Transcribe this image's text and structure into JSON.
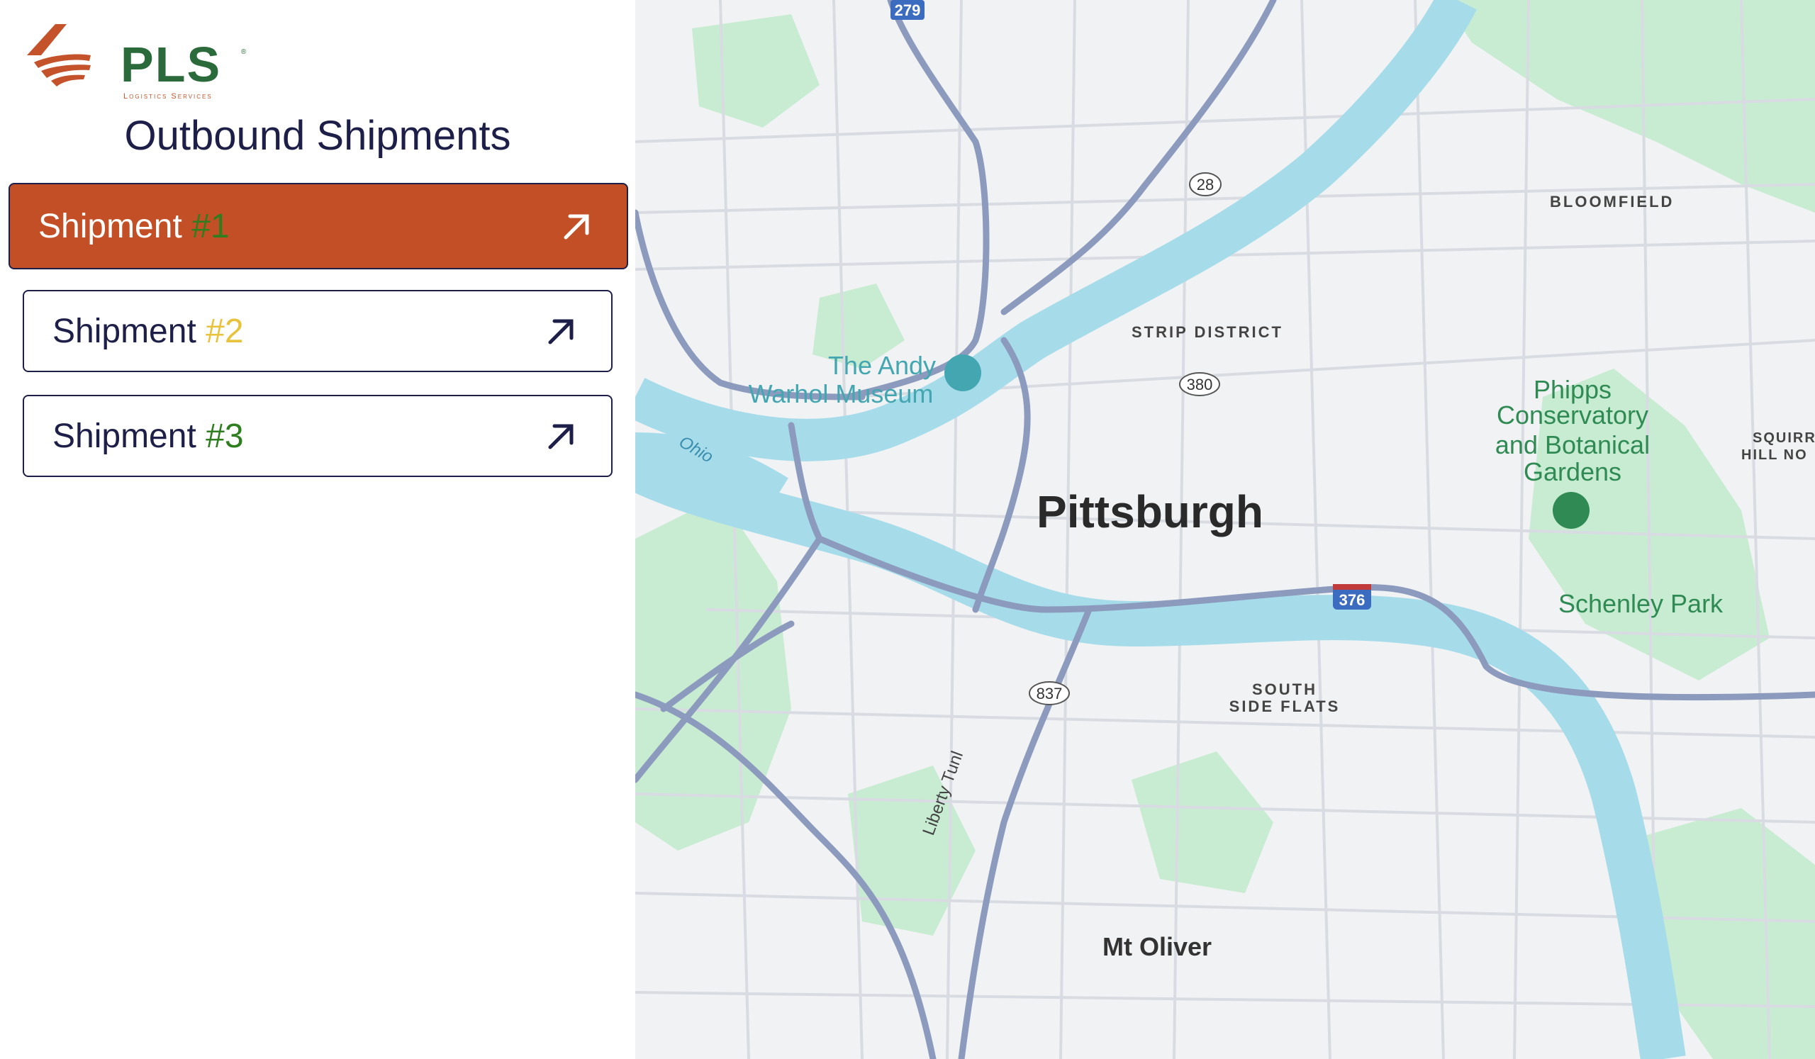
{
  "brand": {
    "name": "PLS",
    "tagline": "Logistics Services",
    "registered": "®",
    "colors": {
      "green": "#2b6a3a",
      "orange": "#c4532b"
    }
  },
  "panel": {
    "title": "Outbound Shipments"
  },
  "shipments": [
    {
      "label": "Shipment ",
      "number": "#1",
      "number_color": "#2e7d1f",
      "active": true,
      "icon": "arrow-up-right-icon"
    },
    {
      "label": "Shipment ",
      "number": "#2",
      "number_color": "#e8c23a",
      "active": false,
      "icon": "arrow-up-right-icon"
    },
    {
      "label": "Shipment ",
      "number": "#3",
      "number_color": "#2e7d1f",
      "active": false,
      "icon": "arrow-up-right-icon"
    }
  ],
  "map": {
    "city": "Pittsburgh",
    "neighborhoods": [
      "BLOOMFIELD",
      "STRIP DISTRICT",
      "SOUTH",
      "SIDE FLATS",
      "SQUIRR",
      "HILL NO"
    ],
    "places": [
      "The Andy",
      "Warhol Museum",
      "Phipps",
      "Conservatory",
      "and Botanical",
      "Gardens",
      "Schenley Park",
      "Mt Oliver"
    ],
    "river": "Ohio",
    "tunnel": "Liberty Tunl",
    "route_shields": [
      "279",
      "28",
      "380",
      "837",
      "376"
    ],
    "colors": {
      "water": "#a6dcea",
      "park": "#c8ecd2",
      "highway": "#8c9bbd",
      "poi": "#43a6b0",
      "park_label": "#2f8a53"
    }
  }
}
